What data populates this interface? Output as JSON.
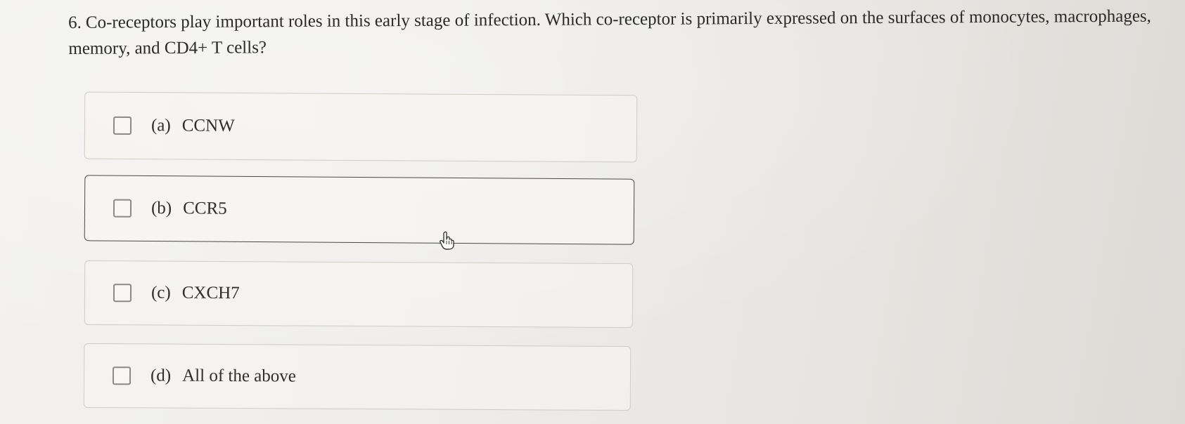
{
  "question": {
    "number": "6.",
    "text": "Co-receptors play important roles in this early stage of infection. Which co-receptor is primarily expressed on the surfaces of monocytes, macrophages, memory, and CD4+ T cells?"
  },
  "options": [
    {
      "letter": "(a)",
      "label": "CCNW",
      "selected": false
    },
    {
      "letter": "(b)",
      "label": "CCR5",
      "selected": false
    },
    {
      "letter": "(c)",
      "label": "CXCH7",
      "selected": false
    },
    {
      "letter": "(d)",
      "label": "All of the above",
      "selected": false
    }
  ],
  "cursor": {
    "icon": "hand-pointer-icon"
  }
}
